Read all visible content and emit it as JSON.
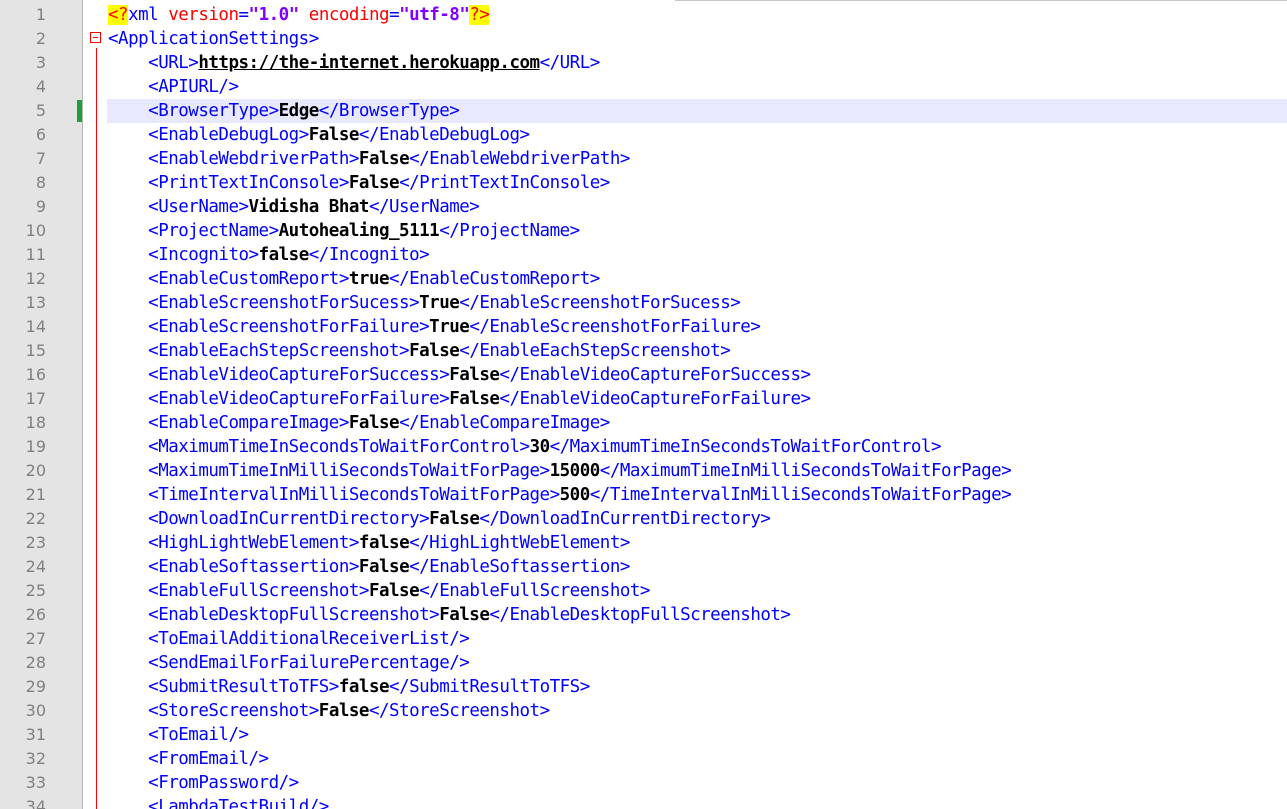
{
  "xml_declaration": {
    "open": "<?",
    "name": "xml",
    "attr1_name": "version",
    "attr1_eq": "=",
    "attr1_value": "\"1.0\"",
    "attr2_name": "encoding",
    "attr2_eq": "=",
    "attr2_value": "\"utf-8\"",
    "close": "?>"
  },
  "root_open": "<ApplicationSettings>",
  "active_line": 5,
  "settings": [
    {
      "tag": "URL",
      "value": "https://the-internet.herokuapp.com",
      "link": true
    },
    {
      "tag": "APIURL",
      "self_closing": true
    },
    {
      "tag": "BrowserType",
      "value": "Edge"
    },
    {
      "tag": "EnableDebugLog",
      "value": "False"
    },
    {
      "tag": "EnableWebdriverPath",
      "value": "False"
    },
    {
      "tag": "PrintTextInConsole",
      "value": "False"
    },
    {
      "tag": "UserName",
      "value": "Vidisha Bhat"
    },
    {
      "tag": "ProjectName",
      "value": "Autohealing_5111"
    },
    {
      "tag": "Incognito",
      "value": "false"
    },
    {
      "tag": "EnableCustomReport",
      "value": "true"
    },
    {
      "tag": "EnableScreenshotForSucess",
      "value": "True"
    },
    {
      "tag": "EnableScreenshotForFailure",
      "value": "True"
    },
    {
      "tag": "EnableEachStepScreenshot",
      "value": "False"
    },
    {
      "tag": "EnableVideoCaptureForSuccess",
      "value": "False"
    },
    {
      "tag": "EnableVideoCaptureForFailure",
      "value": "False"
    },
    {
      "tag": "EnableCompareImage",
      "value": "False"
    },
    {
      "tag": "MaximumTimeInSecondsToWaitForControl",
      "value": "30"
    },
    {
      "tag": "MaximumTimeInMilliSecondsToWaitForPage",
      "value": "15000"
    },
    {
      "tag": "TimeIntervalInMilliSecondsToWaitForPage",
      "value": "500"
    },
    {
      "tag": "DownloadInCurrentDirectory",
      "value": "False"
    },
    {
      "tag": "HighLightWebElement",
      "value": "false"
    },
    {
      "tag": "EnableSoftassertion",
      "value": "False"
    },
    {
      "tag": "EnableFullScreenshot",
      "value": "False"
    },
    {
      "tag": "EnableDesktopFullScreenshot",
      "value": "False"
    },
    {
      "tag": "ToEmailAdditionalReceiverList",
      "self_closing": true
    },
    {
      "tag": "SendEmailForFailurePercentage",
      "self_closing": true
    },
    {
      "tag": "SubmitResultToTFS",
      "value": "false"
    },
    {
      "tag": "StoreScreenshot",
      "value": "False"
    },
    {
      "tag": "ToEmail",
      "self_closing": true
    },
    {
      "tag": "FromEmail",
      "self_closing": true
    },
    {
      "tag": "FromPassword",
      "self_closing": true
    },
    {
      "tag": "LambdaTestBuild",
      "self_closing": true
    }
  ],
  "colors": {
    "tag": "#0000ff",
    "value": "#000000",
    "line_number": "#808080",
    "gutter": "#e4e4e4",
    "current_line": "#e8e8ff",
    "fold_marker": "#ff0000",
    "change_marker": "#1f9e3c",
    "pi_highlight": "#ffff00",
    "attribute": "#ff0000",
    "string": "#8000ff"
  }
}
